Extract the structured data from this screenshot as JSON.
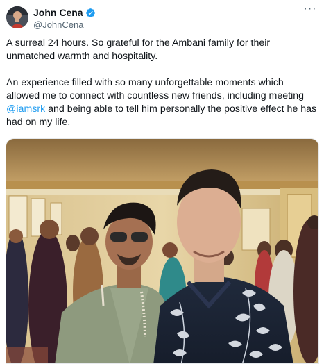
{
  "author": {
    "name": "John Cena",
    "handle": "@JohnCena",
    "verified": true,
    "avatar_icon": "profile-photo"
  },
  "tweet": {
    "line1": "A surreal 24 hours. So grateful for the Ambani family for their unmatched warmth and hospitality.",
    "line2_before": "An experience filled with so many unforgettable moments which allowed me to connect with countless new friends, including meeting ",
    "mention": "@iamsrk",
    "line2_after": " and being able to tell him personally the positive effect he has had on my life."
  },
  "more_menu": "···",
  "colors": {
    "accent": "#1d9bf0",
    "text": "#0f1419",
    "muted": "#536471"
  },
  "media": {
    "type": "photo",
    "icon": "photo-image"
  }
}
